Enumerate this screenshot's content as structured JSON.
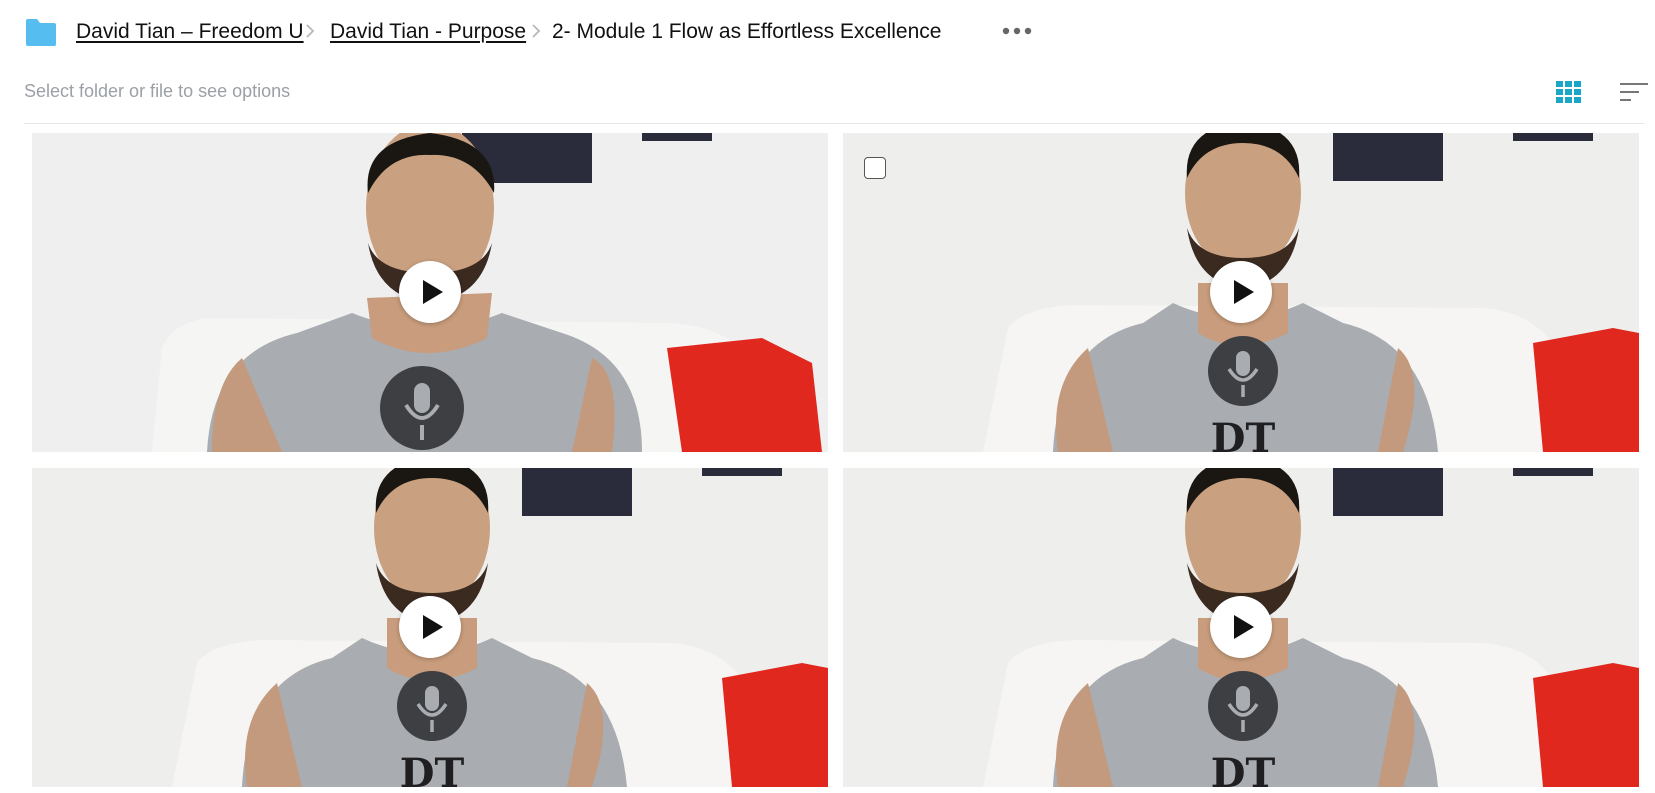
{
  "breadcrumb": {
    "items": [
      {
        "label": "David Tian – Freedom U"
      },
      {
        "label": "David Tian - Purpose"
      },
      {
        "label": "2- Module 1 Flow as Effortless Excellence"
      }
    ]
  },
  "toolbar": {
    "hint": "Select folder or file to see options"
  },
  "colors": {
    "accent": "#1aa7c7",
    "folder": "#55bdf0",
    "shirt_red_pillow": "#e0281f"
  },
  "icons": [
    "folder-icon",
    "chevron-right-icon",
    "more-icon",
    "grid-view-icon",
    "sort-icon",
    "play-icon",
    "microphone-icon"
  ]
}
